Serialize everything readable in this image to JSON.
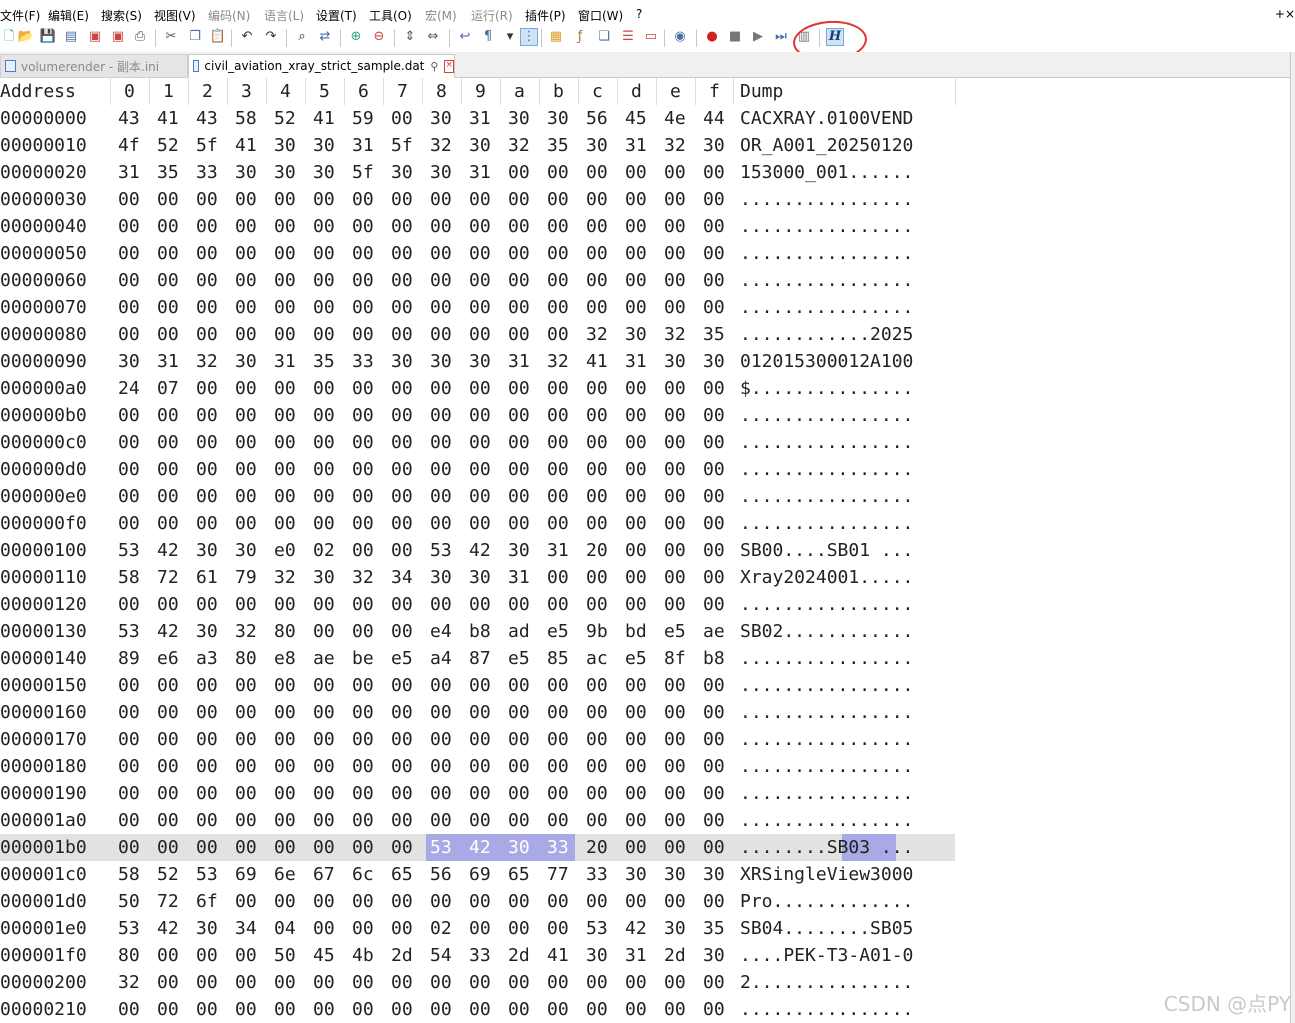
{
  "menu": {
    "items": [
      {
        "label": "文件(F)",
        "disabled": false
      },
      {
        "label": "编辑(E)",
        "disabled": false
      },
      {
        "label": "搜索(S)",
        "disabled": false
      },
      {
        "label": "视图(V)",
        "disabled": false
      },
      {
        "label": "编码(N)",
        "disabled": true
      },
      {
        "label": "语言(L)",
        "disabled": true
      },
      {
        "label": "设置(T)",
        "disabled": false
      },
      {
        "label": "工具(O)",
        "disabled": false
      },
      {
        "label": "宏(M)",
        "disabled": true
      },
      {
        "label": "运行(R)",
        "disabled": true
      },
      {
        "label": "插件(P)",
        "disabled": false
      },
      {
        "label": "窗口(W)",
        "disabled": false
      },
      {
        "label": "?",
        "disabled": false
      }
    ],
    "close_glyph": "+×"
  },
  "toolbar": {
    "hex_button_label": "H",
    "icons": [
      "new-file-icon",
      "open-file-icon",
      "save-icon",
      "save-all-icon",
      "close-icon",
      "close-all-icon",
      "print-icon",
      "cut-icon",
      "copy-icon",
      "paste-icon",
      "undo-icon",
      "redo-icon",
      "find-icon",
      "replace-icon",
      "zoom-in-icon",
      "zoom-out-icon",
      "sync-vertical-icon",
      "sync-horizontal-icon",
      "word-wrap-icon",
      "show-all-chars-icon",
      "dropdown-icon",
      "indent-guide-icon",
      "doc-map-icon",
      "function-list-icon",
      "folder-workspace-icon",
      "doc-list-icon",
      "monitoring-icon",
      "eye-icon",
      "record-macro-icon",
      "stop-macro-icon",
      "play-macro-icon",
      "run-macro-multiple-icon",
      "save-macro-icon",
      "hex-editor-icon"
    ]
  },
  "tabs": [
    {
      "label": "volumerender - 副本.ini",
      "active": false
    },
    {
      "label": "civil_aviation_xray_strict_sample.dat",
      "active": true
    }
  ],
  "hex": {
    "header": {
      "address": "Address",
      "columns": [
        "0",
        "1",
        "2",
        "3",
        "4",
        "5",
        "6",
        "7",
        "8",
        "9",
        "a",
        "b",
        "c",
        "d",
        "e",
        "f"
      ],
      "dump": "Dump"
    },
    "rows": [
      {
        "addr": "00000000",
        "bytes": [
          "43",
          "41",
          "43",
          "58",
          "52",
          "41",
          "59",
          "00",
          "30",
          "31",
          "30",
          "30",
          "56",
          "45",
          "4e",
          "44"
        ],
        "dump": "CACXRAY.0100VEND"
      },
      {
        "addr": "00000010",
        "bytes": [
          "4f",
          "52",
          "5f",
          "41",
          "30",
          "30",
          "31",
          "5f",
          "32",
          "30",
          "32",
          "35",
          "30",
          "31",
          "32",
          "30"
        ],
        "dump": "OR_A001_20250120"
      },
      {
        "addr": "00000020",
        "bytes": [
          "31",
          "35",
          "33",
          "30",
          "30",
          "30",
          "5f",
          "30",
          "30",
          "31",
          "00",
          "00",
          "00",
          "00",
          "00",
          "00"
        ],
        "dump": "153000_001......"
      },
      {
        "addr": "00000030",
        "bytes": [
          "00",
          "00",
          "00",
          "00",
          "00",
          "00",
          "00",
          "00",
          "00",
          "00",
          "00",
          "00",
          "00",
          "00",
          "00",
          "00"
        ],
        "dump": "................"
      },
      {
        "addr": "00000040",
        "bytes": [
          "00",
          "00",
          "00",
          "00",
          "00",
          "00",
          "00",
          "00",
          "00",
          "00",
          "00",
          "00",
          "00",
          "00",
          "00",
          "00"
        ],
        "dump": "................"
      },
      {
        "addr": "00000050",
        "bytes": [
          "00",
          "00",
          "00",
          "00",
          "00",
          "00",
          "00",
          "00",
          "00",
          "00",
          "00",
          "00",
          "00",
          "00",
          "00",
          "00"
        ],
        "dump": "................"
      },
      {
        "addr": "00000060",
        "bytes": [
          "00",
          "00",
          "00",
          "00",
          "00",
          "00",
          "00",
          "00",
          "00",
          "00",
          "00",
          "00",
          "00",
          "00",
          "00",
          "00"
        ],
        "dump": "................"
      },
      {
        "addr": "00000070",
        "bytes": [
          "00",
          "00",
          "00",
          "00",
          "00",
          "00",
          "00",
          "00",
          "00",
          "00",
          "00",
          "00",
          "00",
          "00",
          "00",
          "00"
        ],
        "dump": "................"
      },
      {
        "addr": "00000080",
        "bytes": [
          "00",
          "00",
          "00",
          "00",
          "00",
          "00",
          "00",
          "00",
          "00",
          "00",
          "00",
          "00",
          "32",
          "30",
          "32",
          "35"
        ],
        "dump": "............2025"
      },
      {
        "addr": "00000090",
        "bytes": [
          "30",
          "31",
          "32",
          "30",
          "31",
          "35",
          "33",
          "30",
          "30",
          "30",
          "31",
          "32",
          "41",
          "31",
          "30",
          "30"
        ],
        "dump": "012015300012A100"
      },
      {
        "addr": "000000a0",
        "bytes": [
          "24",
          "07",
          "00",
          "00",
          "00",
          "00",
          "00",
          "00",
          "00",
          "00",
          "00",
          "00",
          "00",
          "00",
          "00",
          "00"
        ],
        "dump": "$..............."
      },
      {
        "addr": "000000b0",
        "bytes": [
          "00",
          "00",
          "00",
          "00",
          "00",
          "00",
          "00",
          "00",
          "00",
          "00",
          "00",
          "00",
          "00",
          "00",
          "00",
          "00"
        ],
        "dump": "................"
      },
      {
        "addr": "000000c0",
        "bytes": [
          "00",
          "00",
          "00",
          "00",
          "00",
          "00",
          "00",
          "00",
          "00",
          "00",
          "00",
          "00",
          "00",
          "00",
          "00",
          "00"
        ],
        "dump": "................"
      },
      {
        "addr": "000000d0",
        "bytes": [
          "00",
          "00",
          "00",
          "00",
          "00",
          "00",
          "00",
          "00",
          "00",
          "00",
          "00",
          "00",
          "00",
          "00",
          "00",
          "00"
        ],
        "dump": "................"
      },
      {
        "addr": "000000e0",
        "bytes": [
          "00",
          "00",
          "00",
          "00",
          "00",
          "00",
          "00",
          "00",
          "00",
          "00",
          "00",
          "00",
          "00",
          "00",
          "00",
          "00"
        ],
        "dump": "................"
      },
      {
        "addr": "000000f0",
        "bytes": [
          "00",
          "00",
          "00",
          "00",
          "00",
          "00",
          "00",
          "00",
          "00",
          "00",
          "00",
          "00",
          "00",
          "00",
          "00",
          "00"
        ],
        "dump": "................"
      },
      {
        "addr": "00000100",
        "bytes": [
          "53",
          "42",
          "30",
          "30",
          "e0",
          "02",
          "00",
          "00",
          "53",
          "42",
          "30",
          "31",
          "20",
          "00",
          "00",
          "00"
        ],
        "dump": "SB00....SB01 ..."
      },
      {
        "addr": "00000110",
        "bytes": [
          "58",
          "72",
          "61",
          "79",
          "32",
          "30",
          "32",
          "34",
          "30",
          "30",
          "31",
          "00",
          "00",
          "00",
          "00",
          "00"
        ],
        "dump": "Xray2024001....."
      },
      {
        "addr": "00000120",
        "bytes": [
          "00",
          "00",
          "00",
          "00",
          "00",
          "00",
          "00",
          "00",
          "00",
          "00",
          "00",
          "00",
          "00",
          "00",
          "00",
          "00"
        ],
        "dump": "................"
      },
      {
        "addr": "00000130",
        "bytes": [
          "53",
          "42",
          "30",
          "32",
          "80",
          "00",
          "00",
          "00",
          "e4",
          "b8",
          "ad",
          "e5",
          "9b",
          "bd",
          "e5",
          "ae"
        ],
        "dump": "SB02............"
      },
      {
        "addr": "00000140",
        "bytes": [
          "89",
          "e6",
          "a3",
          "80",
          "e8",
          "ae",
          "be",
          "e5",
          "a4",
          "87",
          "e5",
          "85",
          "ac",
          "e5",
          "8f",
          "b8"
        ],
        "dump": "................"
      },
      {
        "addr": "00000150",
        "bytes": [
          "00",
          "00",
          "00",
          "00",
          "00",
          "00",
          "00",
          "00",
          "00",
          "00",
          "00",
          "00",
          "00",
          "00",
          "00",
          "00"
        ],
        "dump": "................"
      },
      {
        "addr": "00000160",
        "bytes": [
          "00",
          "00",
          "00",
          "00",
          "00",
          "00",
          "00",
          "00",
          "00",
          "00",
          "00",
          "00",
          "00",
          "00",
          "00",
          "00"
        ],
        "dump": "................"
      },
      {
        "addr": "00000170",
        "bytes": [
          "00",
          "00",
          "00",
          "00",
          "00",
          "00",
          "00",
          "00",
          "00",
          "00",
          "00",
          "00",
          "00",
          "00",
          "00",
          "00"
        ],
        "dump": "................"
      },
      {
        "addr": "00000180",
        "bytes": [
          "00",
          "00",
          "00",
          "00",
          "00",
          "00",
          "00",
          "00",
          "00",
          "00",
          "00",
          "00",
          "00",
          "00",
          "00",
          "00"
        ],
        "dump": "................"
      },
      {
        "addr": "00000190",
        "bytes": [
          "00",
          "00",
          "00",
          "00",
          "00",
          "00",
          "00",
          "00",
          "00",
          "00",
          "00",
          "00",
          "00",
          "00",
          "00",
          "00"
        ],
        "dump": "................"
      },
      {
        "addr": "000001a0",
        "bytes": [
          "00",
          "00",
          "00",
          "00",
          "00",
          "00",
          "00",
          "00",
          "00",
          "00",
          "00",
          "00",
          "00",
          "00",
          "00",
          "00"
        ],
        "dump": "................"
      },
      {
        "addr": "000001b0",
        "bytes": [
          "00",
          "00",
          "00",
          "00",
          "00",
          "00",
          "00",
          "00",
          "53",
          "42",
          "30",
          "33",
          "20",
          "00",
          "00",
          "00"
        ],
        "dump": "........SB03 ...",
        "selected": true,
        "highlight_from": 8,
        "highlight_to": 11
      },
      {
        "addr": "000001c0",
        "bytes": [
          "58",
          "52",
          "53",
          "69",
          "6e",
          "67",
          "6c",
          "65",
          "56",
          "69",
          "65",
          "77",
          "33",
          "30",
          "30",
          "30"
        ],
        "dump": "XRSingleView3000"
      },
      {
        "addr": "000001d0",
        "bytes": [
          "50",
          "72",
          "6f",
          "00",
          "00",
          "00",
          "00",
          "00",
          "00",
          "00",
          "00",
          "00",
          "00",
          "00",
          "00",
          "00"
        ],
        "dump": "Pro............."
      },
      {
        "addr": "000001e0",
        "bytes": [
          "53",
          "42",
          "30",
          "34",
          "04",
          "00",
          "00",
          "00",
          "02",
          "00",
          "00",
          "00",
          "53",
          "42",
          "30",
          "35"
        ],
        "dump": "SB04........SB05"
      },
      {
        "addr": "000001f0",
        "bytes": [
          "80",
          "00",
          "00",
          "00",
          "50",
          "45",
          "4b",
          "2d",
          "54",
          "33",
          "2d",
          "41",
          "30",
          "31",
          "2d",
          "30"
        ],
        "dump": "....PEK-T3-A01-0"
      },
      {
        "addr": "00000200",
        "bytes": [
          "32",
          "00",
          "00",
          "00",
          "00",
          "00",
          "00",
          "00",
          "00",
          "00",
          "00",
          "00",
          "00",
          "00",
          "00",
          "00"
        ],
        "dump": "2..............."
      },
      {
        "addr": "00000210",
        "bytes": [
          "00",
          "00",
          "00",
          "00",
          "00",
          "00",
          "00",
          "00",
          "00",
          "00",
          "00",
          "00",
          "00",
          "00",
          "00",
          "00"
        ],
        "dump": "................"
      }
    ]
  },
  "watermark": "CSDN @点PY",
  "colors": {
    "selection": "#a9a9e6",
    "selected_row": "#e2e2e2",
    "annotation": "#e53030"
  }
}
